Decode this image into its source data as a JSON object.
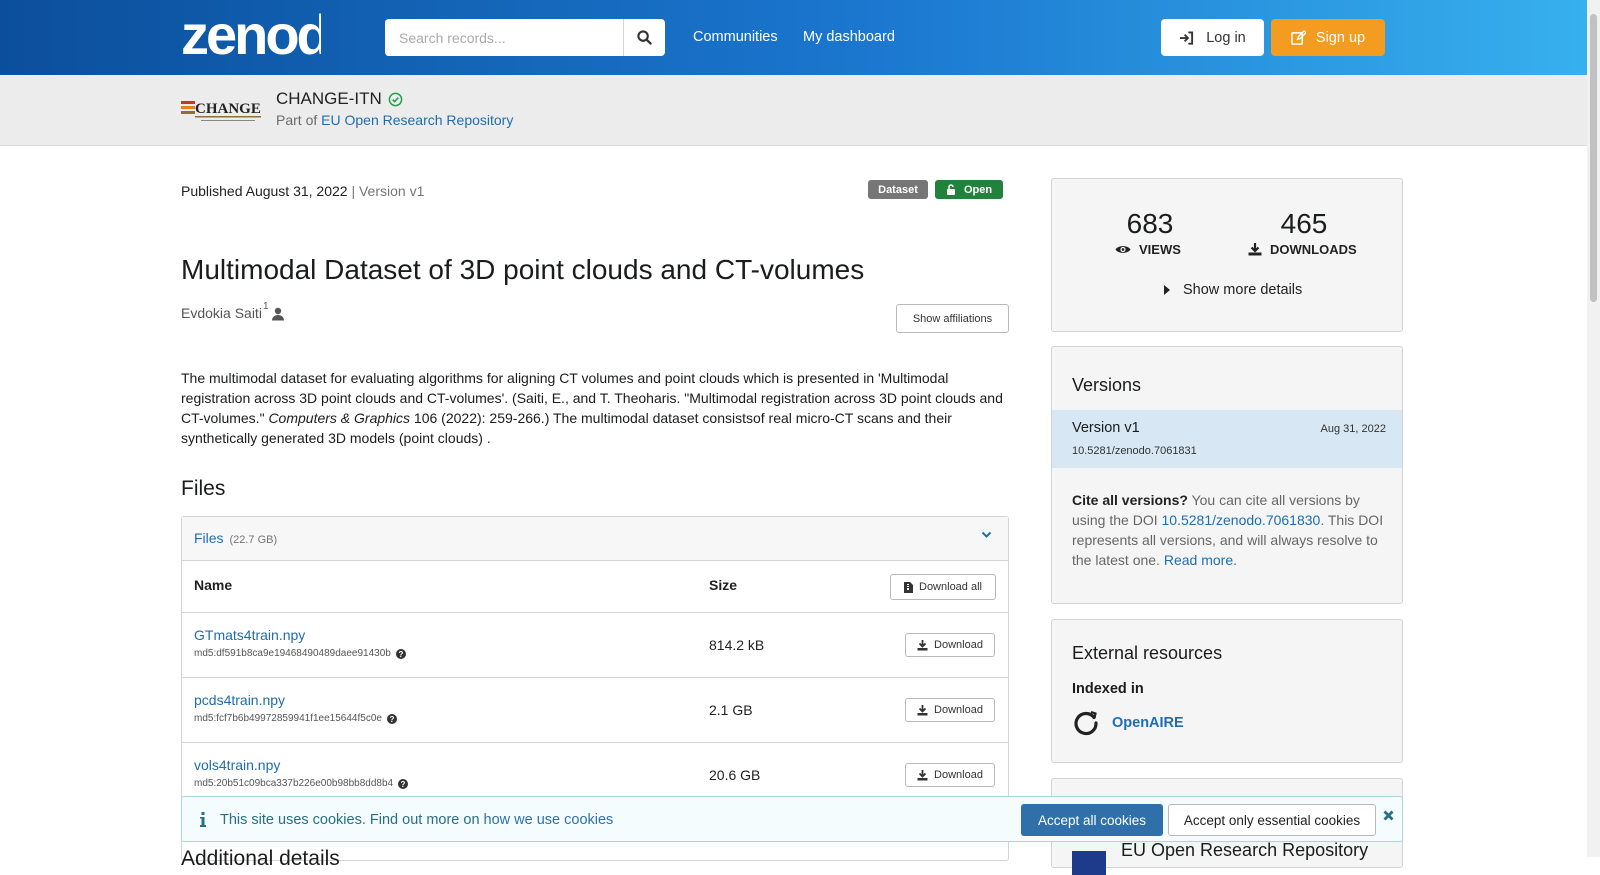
{
  "header": {
    "logo_text": "zenodo",
    "search_placeholder": "Search records...",
    "nav": [
      "Communities",
      "My dashboard"
    ],
    "login_label": "Log in",
    "signup_label": "Sign up"
  },
  "community": {
    "logo_text": "CHANGE",
    "name": "CHANGE-ITN",
    "part_of_prefix": "Part of ",
    "part_of_link": "EU Open Research Repository"
  },
  "record": {
    "published": "Published August 31, 2022",
    "version_text": " | Version v1",
    "badge_type": "Dataset",
    "badge_access": "Open",
    "title": "Multimodal Dataset of 3D point clouds and CT-volumes",
    "creator": "Evdokia Saiti",
    "creator_sup": "1",
    "show_affiliations": "Show affiliations",
    "description_1": "The multimodal dataset for evaluating algorithms for aligning CT volumes and point clouds which is presented in 'Multimodal registration across 3D point clouds and CT-volumes'. (Saiti, E., and T. Theoharis. \"Multimodal registration across 3D point clouds and CT-volumes.\" ",
    "description_journal": "Computers & Graphics",
    "description_2": " 106 (2022): 259-266.) The multimodal dataset consistsof real micro-CT scans and their synthetically generated 3D models (point clouds) ."
  },
  "files": {
    "heading": "Files",
    "accordion_label": "Files",
    "accordion_size": "(22.7 GB)",
    "col_name": "Name",
    "col_size": "Size",
    "download_all": "Download all",
    "download_label": "Download",
    "rows": [
      {
        "name": "GTmats4train.npy",
        "md5": "md5:df591b8ca9e19468490489daee91430b",
        "size": "814.2 kB"
      },
      {
        "name": "pcds4train.npy",
        "md5": "md5:fcf7b6b49972859941f1ee15644f5c0e",
        "size": "2.1 GB"
      },
      {
        "name": "vols4train.npy",
        "md5": "md5:20b51c09bca337b226e00b98bb8dd8b4",
        "size": "20.6 GB"
      }
    ],
    "next_heading": "Additional details"
  },
  "stats": {
    "views": "683",
    "views_label": "VIEWS",
    "downloads": "465",
    "downloads_label": "DOWNLOADS",
    "more_details": "Show more details"
  },
  "versions": {
    "heading": "Versions",
    "version_label": "Version v1",
    "version_date": "Aug 31, 2022",
    "version_doi": "10.5281/zenodo.7061831",
    "cite_bold": "Cite all versions?",
    "cite_text_1": " You can cite all versions by using the DOI ",
    "cite_doi": "10.5281/zenodo.7061830",
    "cite_text_2": ". This DOI represents all versions, and will always resolve to the latest one. ",
    "read_more": "Read more."
  },
  "external": {
    "heading": "External resources",
    "indexed_in": "Indexed in",
    "openaire": "OpenAIRE"
  },
  "next_card": {
    "title": "EU Open Research Repository"
  },
  "cookie": {
    "text": "This site uses cookies. Find out more on ",
    "link": "how we use cookies",
    "accept_all": "Accept all cookies",
    "accept_essential": "Accept only essential cookies"
  },
  "colors": {
    "header_start": "#0b4f9c",
    "header_end": "#37b0ee",
    "signup": "#f39c1f",
    "open_badge": "#21823c",
    "dataset_badge": "#767676",
    "link": "#1f6db0"
  }
}
